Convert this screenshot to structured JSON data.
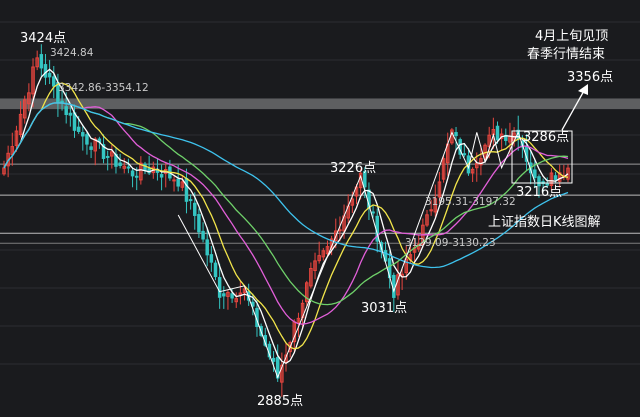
{
  "chart_data": {
    "type": "candlestick",
    "title": "上证指数日K线图解",
    "annotations": {
      "peak_label": "3424点",
      "peak_exact": "3424.84",
      "resist_band_label": "3342.86-3354.12",
      "target_label": "3356点",
      "note_line1": "4月上旬见顶",
      "note_line2": "春季行情结束",
      "box_high_label": "3286点",
      "box_low_label": "3216点",
      "mid_high_label": "3226点",
      "gap1_label": "3195.31-3197.32",
      "gap2_label": "3129.09-3130.23",
      "low1_label": "3031点",
      "low2_label": "2885点"
    },
    "y_range": [
      2860,
      3460
    ],
    "levels": {
      "resist_band": [
        3342.86,
        3354.12
      ],
      "gap1": [
        3195.31,
        3197.32
      ],
      "gap2": [
        3129.09,
        3130.23
      ]
    },
    "key_points": [
      {
        "i": 0,
        "v": 3240
      },
      {
        "i": 8,
        "v": 3424
      },
      {
        "i": 18,
        "v": 3300
      },
      {
        "i": 25,
        "v": 3260
      },
      {
        "i": 31,
        "v": 3232
      },
      {
        "i": 36,
        "v": 3240
      },
      {
        "i": 42,
        "v": 3220
      },
      {
        "i": 46,
        "v": 3160
      },
      {
        "i": 52,
        "v": 3030
      },
      {
        "i": 58,
        "v": 3030
      },
      {
        "i": 66,
        "v": 2885
      },
      {
        "i": 74,
        "v": 3060
      },
      {
        "i": 78,
        "v": 3100
      },
      {
        "i": 86,
        "v": 3226
      },
      {
        "i": 94,
        "v": 3031
      },
      {
        "i": 102,
        "v": 3150
      },
      {
        "i": 108,
        "v": 3300
      },
      {
        "i": 112,
        "v": 3240
      },
      {
        "i": 118,
        "v": 3296
      },
      {
        "i": 124,
        "v": 3300
      },
      {
        "i": 128,
        "v": 3216
      },
      {
        "i": 136,
        "v": 3240
      }
    ],
    "candle_count": 137,
    "ma_series": [
      {
        "color": "#ffffff",
        "period": 5
      },
      {
        "color": "#f2e54b",
        "period": 10
      },
      {
        "color": "#e25fd9",
        "period": 20
      },
      {
        "color": "#6fd16a",
        "period": 30
      },
      {
        "color": "#3ec3ee",
        "period": 60
      }
    ],
    "colors": {
      "up": "#e9463f",
      "down": "#35c5c2",
      "background": "#1a1b1e"
    }
  }
}
